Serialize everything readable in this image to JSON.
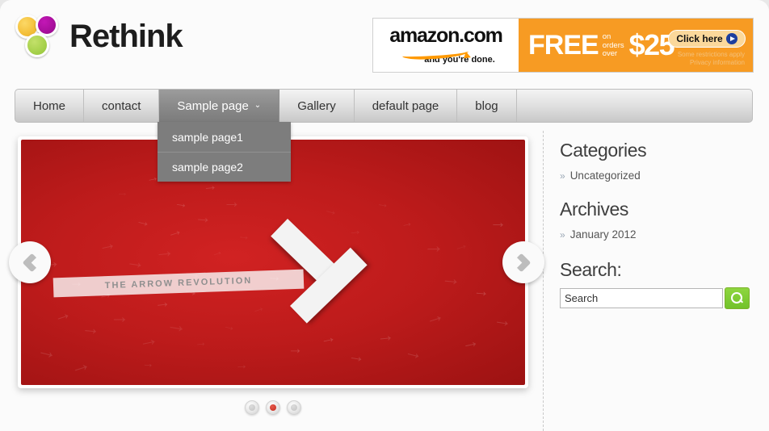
{
  "site": {
    "logo_text": "Rethink",
    "logo_colors": [
      "#f4c13c",
      "#a80f9c",
      "#a8d24d"
    ]
  },
  "banner": {
    "brand": "amazon",
    "domain": ".com",
    "tagline": "and you're done.",
    "free_word": "FREE",
    "on_orders_line1": "on",
    "on_orders_line2": "orders",
    "on_orders_line3": "over",
    "price": "$25",
    "click_here": "Click here",
    "restrictions_line1": "Some restrictions apply",
    "restrictions_line2": "Privacy information",
    "accent_color": "#f79b23"
  },
  "nav": {
    "items": [
      {
        "label": "Home",
        "active": false,
        "has_caret": false
      },
      {
        "label": "contact",
        "active": false,
        "has_caret": false
      },
      {
        "label": "Sample page",
        "active": true,
        "has_caret": true
      },
      {
        "label": "Gallery",
        "active": false,
        "has_caret": false
      },
      {
        "label": "default page",
        "active": false,
        "has_caret": false
      },
      {
        "label": "blog",
        "active": false,
        "has_caret": false
      }
    ],
    "caret_glyph": "⌄"
  },
  "dropdown": {
    "items": [
      {
        "label": "sample page1"
      },
      {
        "label": "sample page2"
      }
    ]
  },
  "slider": {
    "slide_caption": "THE ARROW REVOLUTION",
    "background_color": "#bd1b1b",
    "prev_label": "Previous slide",
    "next_label": "Next slide",
    "dots": [
      {
        "active": false
      },
      {
        "active": true
      },
      {
        "active": false
      }
    ]
  },
  "sidebar": {
    "categories": {
      "heading": "Categories",
      "bullet": "»",
      "items": [
        {
          "label": "Uncategorized"
        }
      ]
    },
    "archives": {
      "heading": "Archives",
      "bullet": "»",
      "items": [
        {
          "label": "January 2012"
        }
      ]
    },
    "search": {
      "heading": "Search:",
      "value": "Search",
      "placeholder": "Search",
      "button_color": "#72c22a"
    }
  }
}
